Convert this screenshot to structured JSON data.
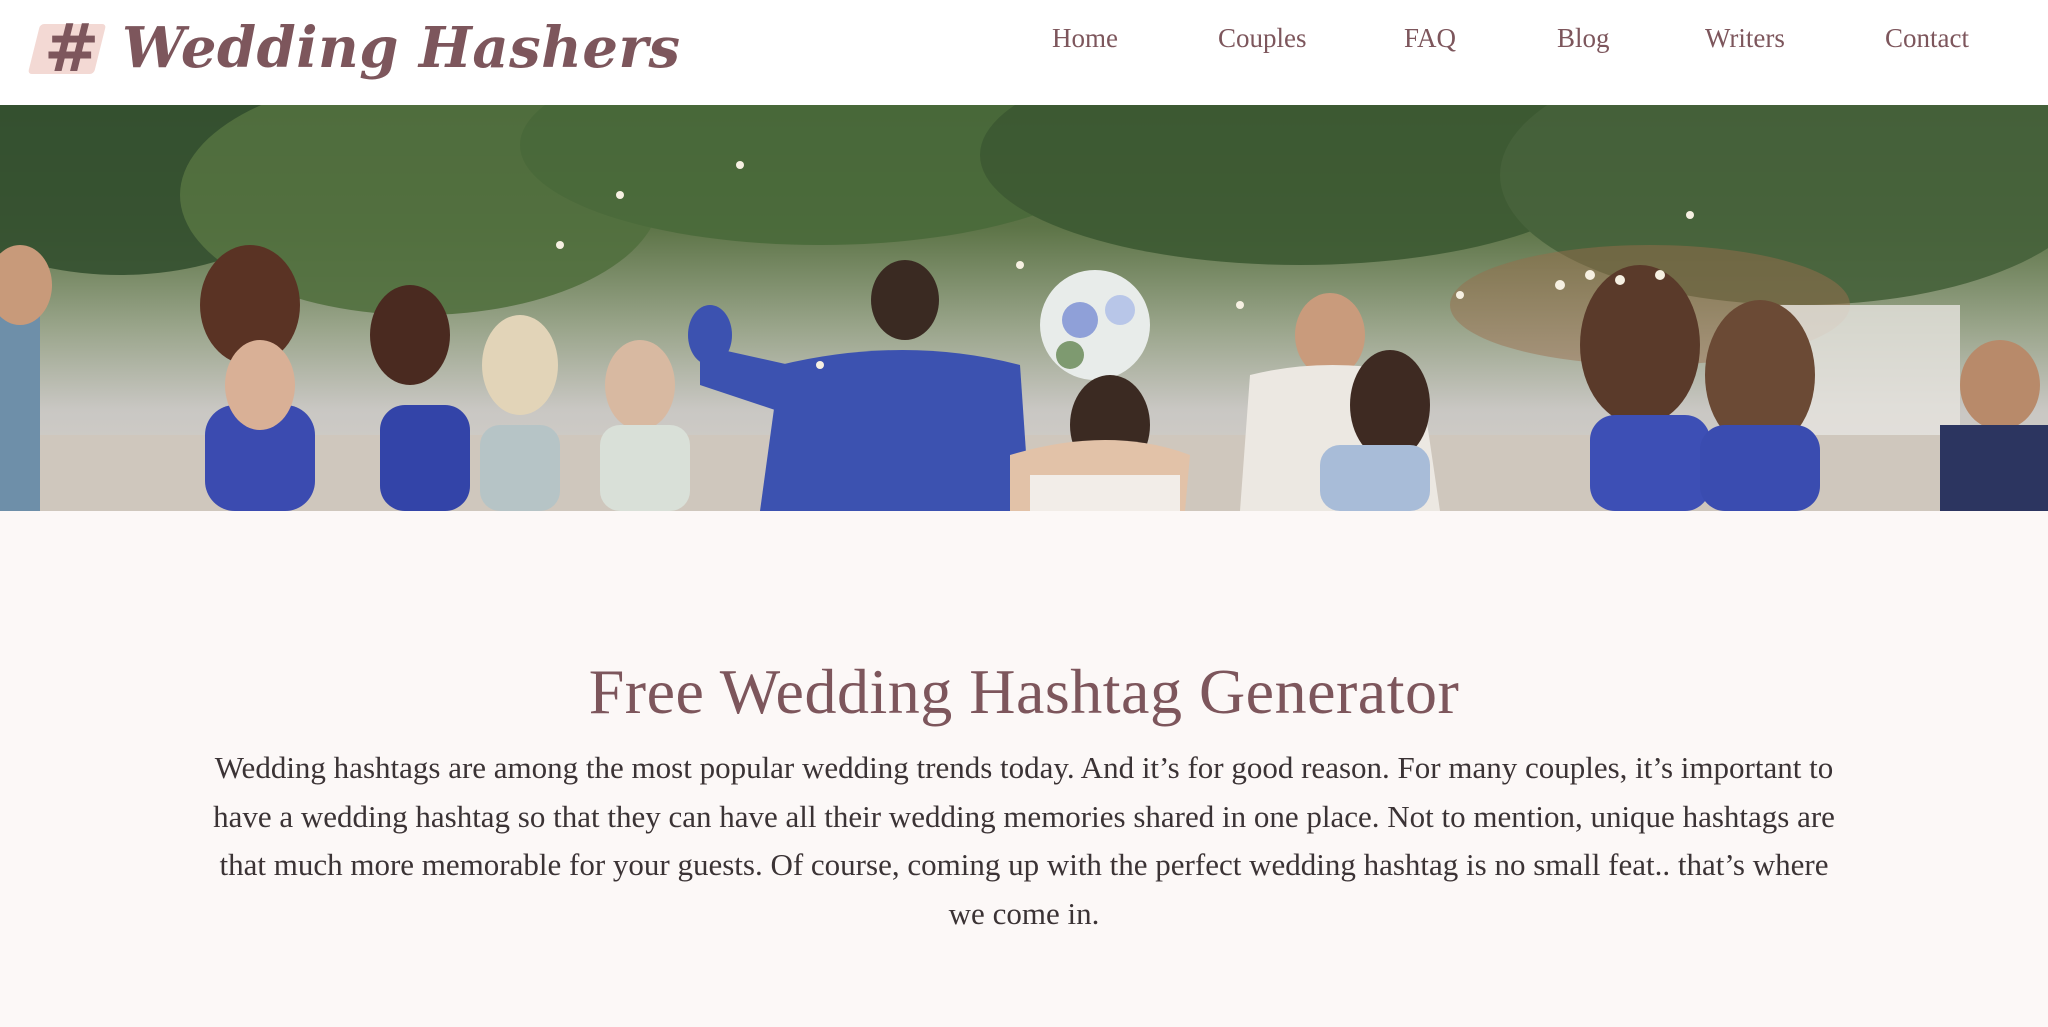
{
  "header": {
    "brand_symbol": "#",
    "brand_name": "Wedding Hashers",
    "nav": [
      "Home",
      "Couples",
      "FAQ",
      "Blog",
      "Writers",
      "Contact"
    ]
  },
  "hero": {
    "image": "wedding-party-photo"
  },
  "main": {
    "title": "Free Wedding Hashtag Generator",
    "intro": "Wedding hashtags are among the most popular wedding trends today. And it’s for good reason. For many couples, it’s important to have a wedding hashtag so that they can have all their wedding memories shared in one place. Not to mention, unique hashtags are that much more memorable for your guests. Of course, coming up with the perfect wedding hashtag is no small feat.. that’s where we come in."
  },
  "colors": {
    "brand": "#7d565c",
    "brand_mark_bg": "#f3d9d4",
    "page_bg": "#fcf8f7",
    "text": "#3b3335"
  }
}
